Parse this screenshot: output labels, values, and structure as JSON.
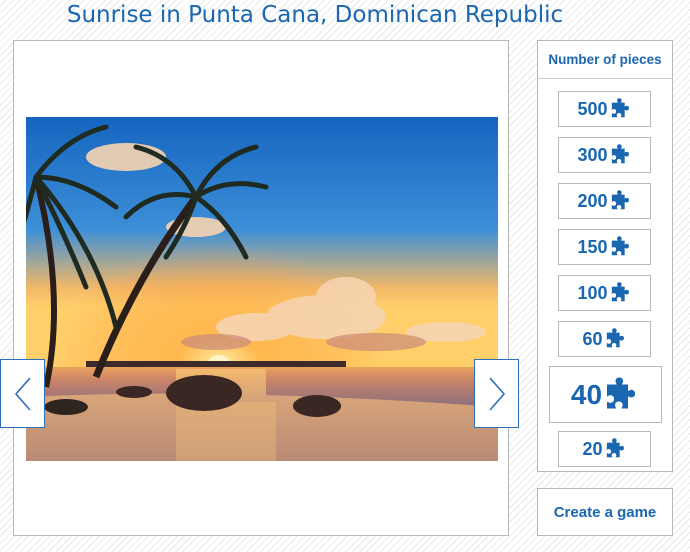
{
  "page": {
    "title": "Sunrise in Punta Cana, Dominican Republic"
  },
  "photo": {
    "subject": "tropical beach sunrise with palm trees"
  },
  "nav": {
    "prev_icon": "chevron-left-icon",
    "next_icon": "chevron-right-icon"
  },
  "pieces": {
    "heading": "Number of pieces",
    "icon": "puzzle-piece-icon",
    "accent": "#1a66b0",
    "options": [
      {
        "label": "500",
        "selected": false
      },
      {
        "label": "300",
        "selected": false
      },
      {
        "label": "200",
        "selected": false
      },
      {
        "label": "150",
        "selected": false
      },
      {
        "label": "100",
        "selected": false
      },
      {
        "label": "60",
        "selected": false
      },
      {
        "label": "40",
        "selected": true
      },
      {
        "label": "20",
        "selected": false
      }
    ]
  },
  "actions": {
    "create_label": "Create a game"
  }
}
